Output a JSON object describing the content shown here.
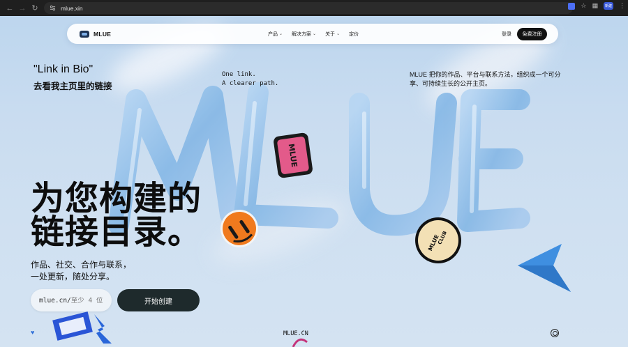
{
  "browser": {
    "url": "mlue.xin",
    "profile_label": "新建"
  },
  "navbar": {
    "brand": "MLUE",
    "links": [
      {
        "label": "产品",
        "has_dropdown": true
      },
      {
        "label": "解决方案",
        "has_dropdown": true
      },
      {
        "label": "关于",
        "has_dropdown": true
      },
      {
        "label": "定价",
        "has_dropdown": false
      }
    ],
    "login": "登录",
    "signup": "免费注册"
  },
  "hero": {
    "link_in_bio": "\"Link in Bio\"",
    "link_in_bio_sub": "去看我主页里的链接",
    "tagline_en_line1": "One link.",
    "tagline_en_line2": "A clearer path.",
    "description": "MLUE 把你的作品、平台与联系方法，组织成一个可分享、可持续生长的公开主页。",
    "headline_line1": "为您构建的",
    "headline_line2": "链接目录。",
    "subline1": "作品、社交、合作与联系，",
    "subline2": "一处更新，随处分享。",
    "input_prefix": "mlue.cn/",
    "input_placeholder": "至少 4 位",
    "cta": "开始创建"
  },
  "art": {
    "big_word": "MLUE",
    "sticker_pink": "MLUE",
    "sticker_club_top": "MLUE",
    "sticker_club_bottom": "CLUB"
  },
  "footer": {
    "domain": "MLUE.CN"
  },
  "colors": {
    "page_bg": "#c9dcf0",
    "tube": "#8fbde9",
    "dark_button": "#1e2a2c",
    "sticker_pink": "#e35a8a",
    "sticker_orange": "#f07a1e",
    "arrow_blue": "#3f8fe0"
  }
}
